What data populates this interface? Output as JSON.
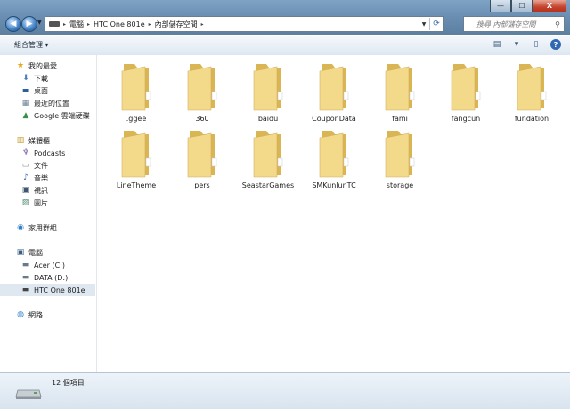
{
  "window": {
    "caption": {
      "minimize": "—",
      "maximize": "☐",
      "close": "X"
    }
  },
  "address": {
    "crumbs": [
      "電腦",
      "HTC One 801e",
      "內部儲存空間"
    ],
    "refresh": "⟳",
    "search_placeholder": "搜尋 內部儲存空間"
  },
  "toolbar": {
    "organize": "組合管理 ▾"
  },
  "nav_pane": {
    "favorites": {
      "label": "我的最愛",
      "items": [
        "下載",
        "桌面",
        "最近的位置",
        "Google 雲端硬碟"
      ]
    },
    "libraries": {
      "label": "媒體櫃",
      "items": [
        "Podcasts",
        "文件",
        "音樂",
        "視訊",
        "圖片"
      ]
    },
    "homegroup": {
      "label": "家用群組"
    },
    "computer": {
      "label": "電腦",
      "items": [
        "Acer (C:)",
        "DATA (D:)",
        "HTC One 801e"
      ]
    },
    "network": {
      "label": "網路"
    }
  },
  "folders": [
    ".ggee",
    "360",
    "baidu",
    "CouponData",
    "fami",
    "fangcun",
    "fundation",
    "LineTheme",
    "pers",
    "SeastarGames",
    "SMKunlunTC",
    "storage"
  ],
  "status": {
    "count": "12 個項目"
  },
  "colors": {
    "folder": "#f3d98a",
    "folder_dark": "#d9b553",
    "accent": "#2f68b0"
  }
}
